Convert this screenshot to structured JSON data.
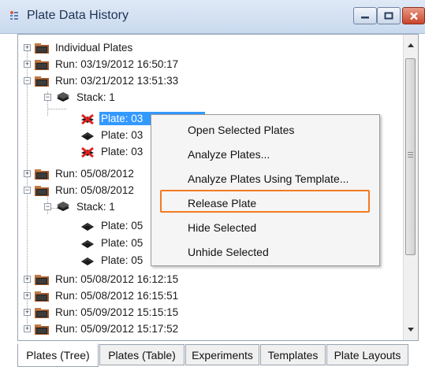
{
  "window": {
    "title": "Plate Data History"
  },
  "tree": {
    "items": [
      {
        "label": "Individual Plates"
      },
      {
        "label": "Run: 03/19/2012 16:50:17"
      },
      {
        "label": "Run: 03/21/2012 13:51:33"
      },
      {
        "label": "Stack: 1"
      },
      {
        "label": "Plate: 03"
      },
      {
        "label": "Plate: 03"
      },
      {
        "label": "Plate: 03"
      },
      {
        "label": "Run: 05/08/2012"
      },
      {
        "label": "Run: 05/08/2012"
      },
      {
        "label": "Stack: 1"
      },
      {
        "label": "Plate: 05"
      },
      {
        "label": "Plate: 05"
      },
      {
        "label": "Plate: 05"
      },
      {
        "label": "Run: 05/08/2012 16:12:15"
      },
      {
        "label": "Run: 05/08/2012 16:15:51"
      },
      {
        "label": "Run: 05/09/2012 15:15:15"
      },
      {
        "label": "Run: 05/09/2012 15:17:52"
      }
    ]
  },
  "context_menu": {
    "items": [
      {
        "label": "Open Selected Plates"
      },
      {
        "label": "Analyze Plates..."
      },
      {
        "label": "Analyze Plates Using Template..."
      },
      {
        "label": "Release Plate"
      },
      {
        "label": "Hide Selected"
      },
      {
        "label": "Unhide Selected"
      }
    ],
    "highlighted": "Release Plate"
  },
  "tabs": [
    {
      "label": "Plates (Tree)",
      "active": true
    },
    {
      "label": "Plates (Table)"
    },
    {
      "label": "Experiments"
    },
    {
      "label": "Templates"
    },
    {
      "label": "Plate Layouts"
    }
  ],
  "colors": {
    "selection": "#3399ff",
    "highlight_box": "#f47a20"
  }
}
